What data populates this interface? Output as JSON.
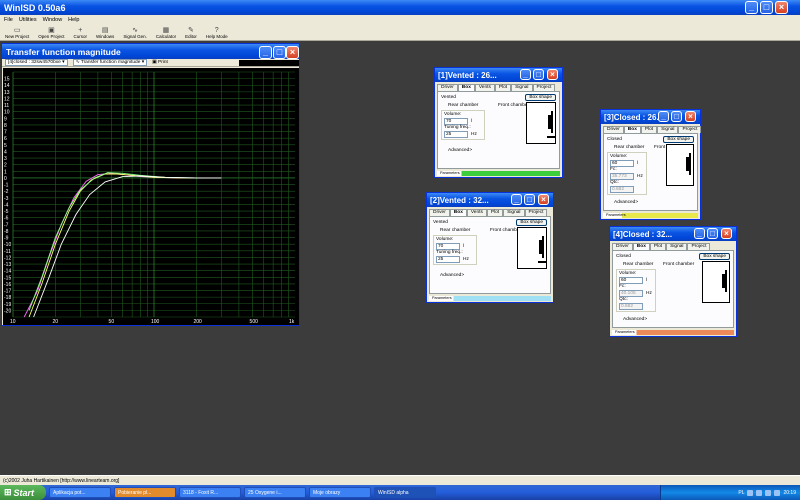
{
  "app": {
    "title": "WinISD 0.50a6",
    "menus": [
      "File",
      "Utilities",
      "Window",
      "Help"
    ],
    "toolbar": [
      {
        "label": "New Project",
        "icon": "new-project-icon",
        "glyph": "▭"
      },
      {
        "label": "Open Project",
        "icon": "open-project-icon",
        "glyph": "▣"
      },
      {
        "label": "Cursor",
        "icon": "cursor-icon",
        "glyph": "+"
      },
      {
        "label": "Windows",
        "icon": "windows-icon",
        "glyph": "▤"
      },
      {
        "label": "Signal Gen.",
        "icon": "signal-gen-icon",
        "glyph": "∿"
      },
      {
        "label": "Calculator",
        "icon": "calculator-icon",
        "glyph": "▦"
      },
      {
        "label": "Editor",
        "icon": "editor-icon",
        "glyph": "✎"
      },
      {
        "label": "Help Mode",
        "icon": "help-icon",
        "glyph": "?"
      }
    ],
    "status": "(c)2002 Juha Hartikainen [http://www.linearteam.org]"
  },
  "tf_window": {
    "title": "Transfer function magnitude",
    "combo_project": "[4]closed : 32sw4570bxe",
    "combo_graph": "Transfer function magnitude",
    "print_label": "Print"
  },
  "chart_data": {
    "type": "line",
    "xlabel": "",
    "ylabel": "",
    "xscale": "log",
    "xlim": [
      10,
      1000
    ],
    "ylim": [
      -21,
      16
    ],
    "x_ticks": [
      "10",
      "20",
      "50",
      "100",
      "200",
      "500",
      "1k"
    ],
    "y_ticks": [
      "15",
      "14",
      "13",
      "12",
      "11",
      "10",
      "9",
      "8",
      "7",
      "6",
      "5",
      "4",
      "3",
      "2",
      "1",
      "0",
      "-1",
      "-2",
      "-3",
      "-4",
      "-5",
      "-6",
      "-7",
      "-8",
      "-9",
      "-10",
      "-11",
      "-12",
      "-13",
      "-14",
      "-15",
      "-16",
      "-17",
      "-18",
      "-19",
      "-20"
    ],
    "grid": true,
    "series": [
      {
        "color": "#ff66ff",
        "x": [
          12,
          15,
          18,
          22,
          27,
          33,
          40,
          50,
          60,
          80,
          100,
          150,
          200,
          230
        ],
        "y": [
          -21,
          -17,
          -12,
          -7,
          -3,
          -0.5,
          0.5,
          0.7,
          0.5,
          0.2,
          0.1,
          0,
          0,
          0
        ]
      },
      {
        "color": "#ffff66",
        "x": [
          13,
          16,
          20,
          25,
          30,
          36,
          45,
          55,
          70,
          100,
          150,
          200,
          230
        ],
        "y": [
          -21,
          -16,
          -10,
          -5,
          -2,
          -0.3,
          0.6,
          0.6,
          0.4,
          0.1,
          0,
          0,
          0
        ]
      },
      {
        "color": "#88ff88",
        "x": [
          13,
          16,
          20,
          25,
          30,
          38,
          47,
          60,
          80,
          120,
          200,
          300
        ],
        "y": [
          -20,
          -15,
          -9,
          -4.5,
          -1.8,
          0,
          0.8,
          0.7,
          0.4,
          0.1,
          0,
          0
        ]
      },
      {
        "color": "#ffffff",
        "x": [
          14,
          18,
          22,
          28,
          35,
          45,
          60,
          80,
          120,
          200,
          300
        ],
        "y": [
          -21,
          -15,
          -10,
          -5.5,
          -2.5,
          -0.6,
          0.2,
          0.3,
          0.1,
          0,
          0
        ]
      }
    ]
  },
  "driver_windows": [
    {
      "title": "[1]Vented : 26...",
      "tabs": [
        "Driver",
        "Box",
        "Vents",
        "Plot",
        "Signal",
        "Project"
      ],
      "selected_tab": "Box",
      "enclosure": "Vented",
      "chambers": [
        "Rear chamber",
        "Front chamber"
      ],
      "box_shape": "Box shape",
      "fields": [
        {
          "label": "Volume:",
          "value": "70",
          "unit": "l",
          "disabled": false
        },
        {
          "label": "Tuning freq.:",
          "value": "25",
          "unit": "Hz",
          "disabled": false
        }
      ],
      "advanced": "Advanced>",
      "progress_label": "Parameters",
      "accent": "#3ccc3c"
    },
    {
      "title": "[2]Vented : 32...",
      "tabs": [
        "Driver",
        "Box",
        "Vents",
        "Plot",
        "Signal",
        "Project"
      ],
      "selected_tab": "Box",
      "enclosure": "Vented",
      "chambers": [
        "Rear chamber",
        "Front chamber"
      ],
      "box_shape": "Box shape",
      "fields": [
        {
          "label": "Volume:",
          "value": "70",
          "unit": "l",
          "disabled": false
        },
        {
          "label": "Tuning freq.:",
          "value": "25",
          "unit": "Hz",
          "disabled": false
        }
      ],
      "advanced": "Advanced>",
      "progress_label": "Parameters",
      "accent": "#9fe0f5"
    },
    {
      "title": "[3]Closed : 26...",
      "tabs": [
        "Driver",
        "Box",
        "Plot",
        "Signal",
        "Project"
      ],
      "selected_tab": "Box",
      "enclosure": "Closed",
      "chambers": [
        "Rear chamber",
        "Front chamber"
      ],
      "box_shape": "Box shape",
      "fields": [
        {
          "label": "Volume:",
          "value": "60",
          "unit": "l",
          "disabled": false
        },
        {
          "label": "Fc:",
          "value": "35.773",
          "unit": "Hz",
          "disabled": true
        },
        {
          "label": "Qtc:",
          "value": "0.682",
          "unit": "",
          "disabled": true
        }
      ],
      "advanced": "Advanced>",
      "progress_label": "Parameters",
      "accent": "#e8e84a"
    },
    {
      "title": "[4]Closed : 32...",
      "tabs": [
        "Driver",
        "Box",
        "Plot",
        "Signal",
        "Project"
      ],
      "selected_tab": "Box",
      "enclosure": "Closed",
      "chambers": [
        "Rear chamber",
        "Front chamber"
      ],
      "box_shape": "Box shape",
      "fields": [
        {
          "label": "Volume:",
          "value": "60",
          "unit": "l",
          "disabled": false
        },
        {
          "label": "Fc:",
          "value": "40.105",
          "unit": "Hz",
          "disabled": true
        },
        {
          "label": "Qtc:",
          "value": "0.682",
          "unit": "",
          "disabled": true
        }
      ],
      "advanced": "Advanced>",
      "progress_label": "Parameters",
      "accent": "#ee8a5a"
    }
  ],
  "taskbar": {
    "start": "Start",
    "tasks": [
      {
        "label": "Aplikacja pot...",
        "active": false,
        "alert": false
      },
      {
        "label": "Pobieranie pl...",
        "active": false,
        "alert": true
      },
      {
        "label": "3118 - Foxit R...",
        "active": false,
        "alert": false
      },
      {
        "label": "25 Oxygene i...",
        "active": false,
        "alert": false
      },
      {
        "label": "Moje obrazy",
        "active": false,
        "alert": false
      },
      {
        "label": "WinISD alpha",
        "active": true,
        "alert": false
      }
    ],
    "lang": "PL",
    "clock": "20:19"
  }
}
